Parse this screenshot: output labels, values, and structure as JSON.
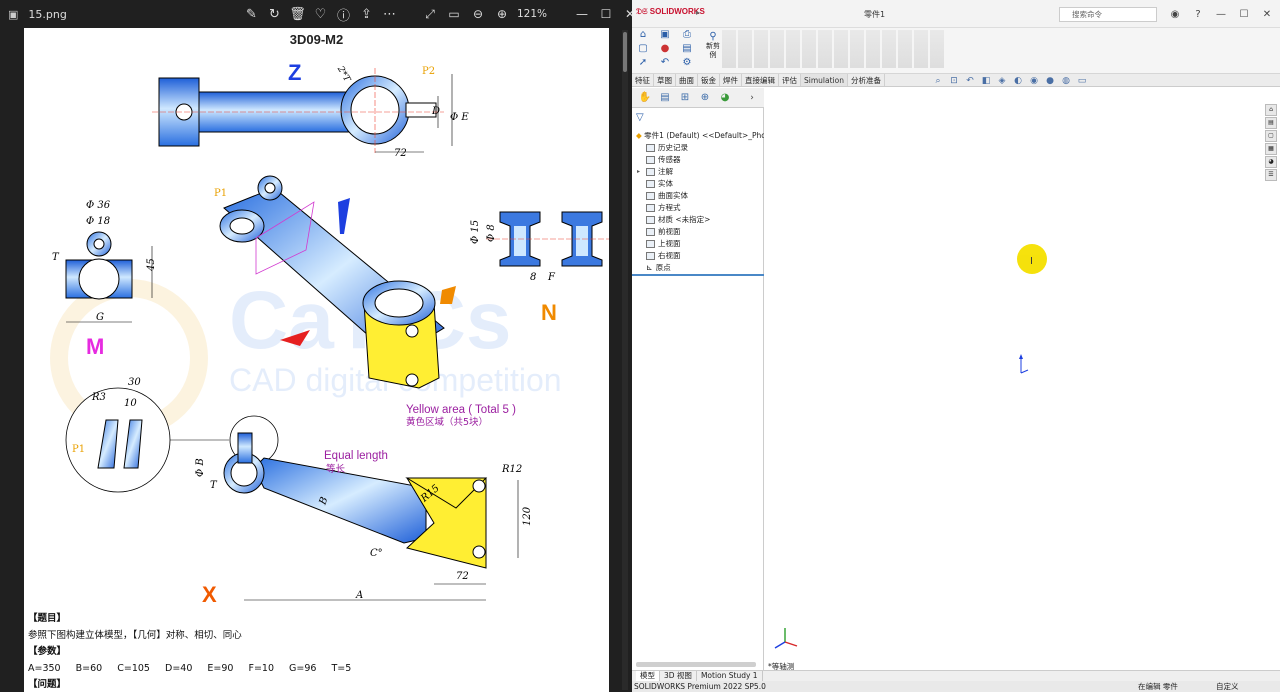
{
  "viewer": {
    "filename": "15.png",
    "zoom": "121%",
    "tool_icons": [
      "edit-icon",
      "rotate-icon",
      "delete-icon",
      "heart-icon",
      "info-icon",
      "share-icon",
      "more-icon"
    ],
    "window_icons": [
      "expand-icon",
      "fit-icon",
      "zoom-out-icon",
      "zoom-in-icon"
    ],
    "window_controls": [
      "minimize",
      "maximize",
      "close"
    ]
  },
  "drawing": {
    "title": "3D09-M2",
    "view_letters": {
      "z": "Z",
      "m": "M",
      "n": "N",
      "x": "X"
    },
    "labels": {
      "p1": "P1",
      "p2": "P2",
      "two_t": "2*T",
      "d": "D",
      "phi_e": "Φ E",
      "dim72_top": "72",
      "phi36": "Φ 36",
      "phi18": "Φ 18",
      "t": "T",
      "dim45": "45",
      "g": "G",
      "phi15": "Φ 15",
      "phi8": "Φ 8",
      "dim8": "8",
      "f": "F",
      "yellow_en": "Yellow area ( Total 5 )",
      "yellow_cn": "黄色区域（共5块）",
      "dim30": "30",
      "r3": "R3",
      "dim10": "10",
      "p1b": "P1",
      "equal_en": "Equal length",
      "equal_cn": "等长",
      "phi_b": "Φ B",
      "t2": "T",
      "b": "B",
      "r12": "R12",
      "r15": "R15",
      "dim120": "120",
      "c": "C°",
      "dim72_bot": "72",
      "a": "A"
    },
    "watermark": "CAD digital competition"
  },
  "doc_text": {
    "h_problem": "【题目】",
    "problem": "参照下图构建立体模型，【几何】对称、相切、同心",
    "h_params": "【参数】",
    "params": [
      "A=350",
      "B=60",
      "C=105",
      "D=40",
      "E=90",
      "F=10",
      "G=96",
      "T=5"
    ],
    "h_question": "【问题】"
  },
  "solidworks": {
    "logo": "SOLIDWORKS",
    "doc_title": "零件1",
    "search_placeholder": "搜索命令",
    "feature_btn": "新剪例",
    "ribbon_tabs": [
      "特征",
      "草图",
      "曲面",
      "钣金",
      "焊件",
      "直接编辑",
      "评估",
      "Simulation",
      "分析准备"
    ],
    "tree_root": "零件1 (Default) <<Default>_Photo\\",
    "tree_items": [
      {
        "label": "历史记录"
      },
      {
        "label": "传感器"
      },
      {
        "label": "注解",
        "expandable": true
      },
      {
        "label": "实体"
      },
      {
        "label": "曲面实体"
      },
      {
        "label": "方程式"
      },
      {
        "label": "材质 <未指定>"
      },
      {
        "label": "前视面"
      },
      {
        "label": "上视面"
      },
      {
        "label": "右视面"
      },
      {
        "label": "原点"
      }
    ],
    "bottom_tabs": [
      "模型",
      "3D 视图",
      "Motion Study 1"
    ],
    "view_label": "*等轴测",
    "status_left": "SOLIDWORKS Premium 2022 SP5.0",
    "status_mid": "在编辑 零件",
    "status_right": "自定义"
  }
}
